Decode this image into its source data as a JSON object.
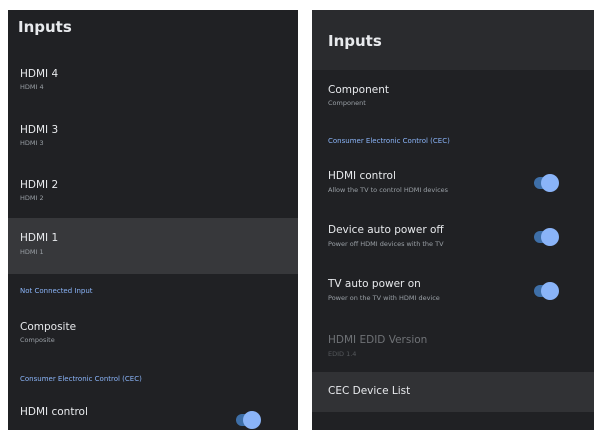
{
  "left": {
    "title": "Inputs",
    "items": [
      {
        "title": "HDMI 4",
        "subtitle": "HDMI 4"
      },
      {
        "title": "HDMI 3",
        "subtitle": "HDMI 3"
      },
      {
        "title": "HDMI 2",
        "subtitle": "HDMI 2"
      },
      {
        "title": "HDMI 1",
        "subtitle": "HDMI 1"
      }
    ],
    "section_not_connected": "Not Connected Input",
    "composite": {
      "title": "Composite",
      "subtitle": "Composite"
    },
    "section_cec": "Consumer Electronic Control (CEC)",
    "hdmi_control": {
      "title": "HDMI control",
      "enabled": true
    }
  },
  "right": {
    "title": "Inputs",
    "component": {
      "title": "Component",
      "subtitle": "Component"
    },
    "section_cec": "Consumer Electronic Control (CEC)",
    "toggles": [
      {
        "title": "HDMI control",
        "subtitle": "Allow the TV to control HDMI devices",
        "enabled": true
      },
      {
        "title": "Device auto power off",
        "subtitle": "Power off HDMI devices with the TV",
        "enabled": true
      },
      {
        "title": "TV auto power on",
        "subtitle": "Power on the TV with HDMI device",
        "enabled": true
      }
    ],
    "disabled_item": {
      "title": "HDMI EDID Version",
      "subtitle": "EDID 1.4"
    },
    "cec_device_list": "CEC Device List"
  },
  "colors": {
    "background": "#202124",
    "accent": "#8ab4f8",
    "toggle_track": "#3e6fa8",
    "selected_row": "#37383b"
  }
}
